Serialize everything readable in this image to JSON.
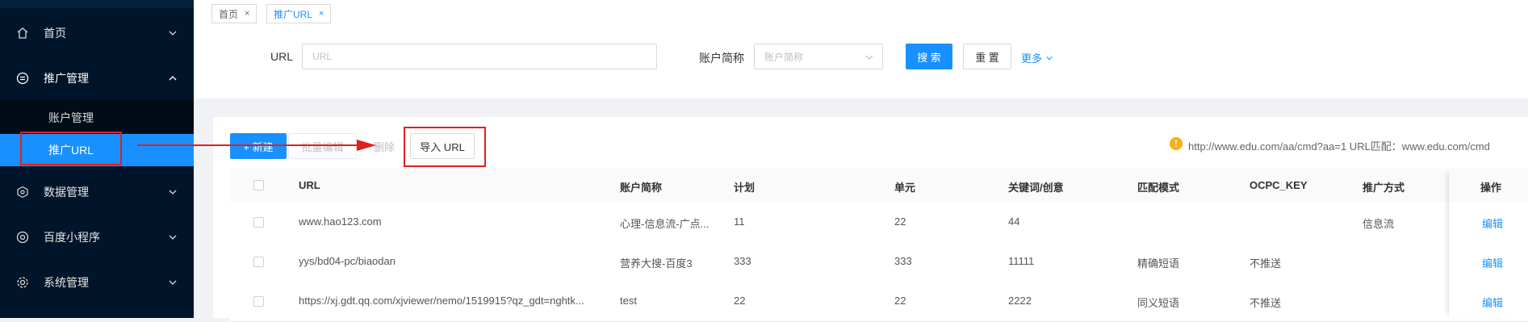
{
  "sidebar": {
    "items": [
      {
        "label": "首页",
        "icon": "home-icon"
      },
      {
        "label": "推广管理",
        "icon": "promotion-icon"
      },
      {
        "label": "数据管理",
        "icon": "data-icon"
      },
      {
        "label": "百度小程序",
        "icon": "miniprogram-icon"
      },
      {
        "label": "系统管理",
        "icon": "settings-icon"
      }
    ],
    "sub_items": [
      {
        "label": "账户管理"
      },
      {
        "label": "推广URL",
        "active": true
      }
    ]
  },
  "tabs": [
    {
      "label": "首页",
      "close": "×"
    },
    {
      "label": "推广URL",
      "close": "×",
      "active": true
    }
  ],
  "search": {
    "url_label": "URL",
    "url_placeholder": "URL",
    "account_label": "账户简称",
    "account_placeholder": "账户简称",
    "search_btn": "搜 索",
    "reset_btn": "重 置",
    "more_link": "更多"
  },
  "toolbar": {
    "new_btn": "+ 新建",
    "batch_btn": "批量编辑",
    "delete_btn": "删除",
    "import_btn": "导入 URL",
    "hint_text": "http://www.edu.com/aa/cmd?aa=1 URL匹配：www.edu.com/cmd"
  },
  "table": {
    "columns": [
      "URL",
      "账户简称",
      "计划",
      "单元",
      "关键词/创意",
      "匹配模式",
      "OCPC_KEY",
      "推广方式",
      "操作"
    ],
    "rows": [
      {
        "url": "www.hao123.com",
        "account": "心理-信息流-广点...",
        "plan": "11",
        "unit": "22",
        "keyword": "44",
        "match": "",
        "ocpc": "",
        "method": "信息流",
        "action": "编辑"
      },
      {
        "url": "yys/bd04-pc/biaodan",
        "account": "营养大搜-百度3",
        "plan": "333",
        "unit": "333",
        "keyword": "11111",
        "match": "精确短语",
        "ocpc": "不推送",
        "method": "",
        "action": "编辑"
      },
      {
        "url": "https://xj.gdt.qq.com/xjviewer/nemo/1519915?qz_gdt=nghtk...",
        "account": "test",
        "plan": "22",
        "unit": "22",
        "keyword": "2222",
        "match": "同义短语",
        "ocpc": "不推送",
        "method": "",
        "action": "编辑"
      }
    ]
  },
  "colors": {
    "accent": "#1890ff",
    "sidebar": "#001529",
    "annotation": "#e02020"
  }
}
